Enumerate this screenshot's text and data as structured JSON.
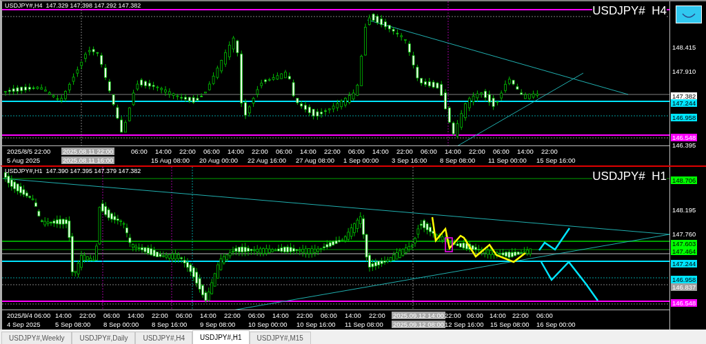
{
  "panels": [
    {
      "header": "USDJPY#,H4  147.329 147.398 147.292 147.382",
      "symbol_label": "USDJPY#  H4",
      "active": false,
      "price_axis": [
        {
          "text": "148.415",
          "kind": "tick"
        },
        {
          "text": "147.910",
          "kind": "tick"
        },
        {
          "text": "147.382",
          "kind": "marker",
          "color": "#ffffff"
        },
        {
          "text": "147.244",
          "kind": "marker",
          "color": "#00e5ff"
        },
        {
          "text": "146.958",
          "kind": "marker",
          "color": "#00e5ff"
        },
        {
          "text": "146.548",
          "kind": "marker",
          "color": "#ff00ff"
        },
        {
          "text": "146.395",
          "kind": "tick"
        }
      ],
      "time_axis_top": [
        {
          "text": "2025/8/5 22:00",
          "kind": "tick"
        },
        {
          "text": "2025.08.11 22:00",
          "kind": "cursor"
        },
        {
          "text": "06:00",
          "kind": "tick"
        },
        {
          "text": "14:00",
          "kind": "tick"
        },
        {
          "text": "22:00",
          "kind": "tick"
        },
        {
          "text": "06:00",
          "kind": "tick"
        },
        {
          "text": "14:00",
          "kind": "tick"
        },
        {
          "text": "22:00",
          "kind": "tick"
        },
        {
          "text": "06:00",
          "kind": "tick"
        },
        {
          "text": "14:00",
          "kind": "tick"
        },
        {
          "text": "22:00",
          "kind": "tick"
        },
        {
          "text": "06:00",
          "kind": "tick"
        },
        {
          "text": "14:00",
          "kind": "tick"
        },
        {
          "text": "22:00",
          "kind": "tick"
        },
        {
          "text": "06:00",
          "kind": "tick"
        },
        {
          "text": "14:00",
          "kind": "tick"
        },
        {
          "text": "22:00",
          "kind": "tick"
        },
        {
          "text": "06:00",
          "kind": "tick"
        },
        {
          "text": "14:00",
          "kind": "tick"
        },
        {
          "text": "22:00",
          "kind": "tick"
        }
      ],
      "time_axis_bottom": [
        {
          "text": "5 Aug 2025",
          "kind": "tick"
        },
        {
          "text": "2025.08.11 16:00",
          "kind": "cursor"
        },
        {
          "text": "15 Aug 08:00",
          "kind": "tick"
        },
        {
          "text": "20 Aug 00:00",
          "kind": "tick"
        },
        {
          "text": "22 Aug 16:00",
          "kind": "tick"
        },
        {
          "text": "27 Aug 08:00",
          "kind": "tick"
        },
        {
          "text": "1 Sep 00:00",
          "kind": "tick"
        },
        {
          "text": "3 Sep 16:00",
          "kind": "tick"
        },
        {
          "text": "8 Sep 08:00",
          "kind": "tick"
        },
        {
          "text": "11 Sep 00:00",
          "kind": "tick"
        },
        {
          "text": "15 Sep 16:00",
          "kind": "tick"
        }
      ]
    },
    {
      "header": "USDJPY#,H1  147.390 147.395 147.379 147.382",
      "symbol_label": "USDJPY#  H1",
      "active": true,
      "price_axis": [
        {
          "text": "148.706",
          "kind": "marker",
          "color": "#00ff00"
        },
        {
          "text": "148.195",
          "kind": "tick"
        },
        {
          "text": "147.760",
          "kind": "tick"
        },
        {
          "text": "147.603",
          "kind": "marker",
          "color": "#00ff00"
        },
        {
          "text": "147.464",
          "kind": "marker",
          "color": "#00ff00"
        },
        {
          "text": "147.244",
          "kind": "marker",
          "color": "#00e5ff"
        },
        {
          "text": "146.958",
          "kind": "marker",
          "color": "#00e5ff"
        },
        {
          "text": "146.837",
          "kind": "marker",
          "color": "#a0a0a0"
        },
        {
          "text": "146.548",
          "kind": "marker",
          "color": "#ff00ff"
        }
      ],
      "time_axis_top": [
        {
          "text": "2025/9/4 06:00",
          "kind": "tick"
        },
        {
          "text": "14:00",
          "kind": "tick"
        },
        {
          "text": "22:00",
          "kind": "tick"
        },
        {
          "text": "06:00",
          "kind": "tick"
        },
        {
          "text": "14:00",
          "kind": "tick"
        },
        {
          "text": "22:00",
          "kind": "tick"
        },
        {
          "text": "06:00",
          "kind": "tick"
        },
        {
          "text": "14:00",
          "kind": "tick"
        },
        {
          "text": "22:00",
          "kind": "tick"
        },
        {
          "text": "06:00",
          "kind": "tick"
        },
        {
          "text": "14:00",
          "kind": "tick"
        },
        {
          "text": "22:00",
          "kind": "tick"
        },
        {
          "text": "06:00",
          "kind": "tick"
        },
        {
          "text": "14:00",
          "kind": "tick"
        },
        {
          "text": "22:00",
          "kind": "tick"
        },
        {
          "text": "2025.09.12 14:00",
          "kind": "cursor"
        },
        {
          "text": "22:00",
          "kind": "tick"
        },
        {
          "text": "06:00",
          "kind": "tick"
        },
        {
          "text": "14:00",
          "kind": "tick"
        },
        {
          "text": "22:00",
          "kind": "tick"
        },
        {
          "text": "06:00",
          "kind": "tick"
        }
      ],
      "time_axis_bottom": [
        {
          "text": "4 Sep 2025",
          "kind": "tick"
        },
        {
          "text": "5 Sep 08:00",
          "kind": "tick"
        },
        {
          "text": "8 Sep 00:00",
          "kind": "tick"
        },
        {
          "text": "8 Sep 16:00",
          "kind": "tick"
        },
        {
          "text": "9 Sep 08:00",
          "kind": "tick"
        },
        {
          "text": "10 Sep 00:00",
          "kind": "tick"
        },
        {
          "text": "10 Sep 16:00",
          "kind": "tick"
        },
        {
          "text": "11 Sep 08:00",
          "kind": "tick"
        },
        {
          "text": "2025.09.12 08:00",
          "kind": "cursor"
        },
        {
          "text": "12 Sep 16:00",
          "kind": "tick"
        },
        {
          "text": "15 Sep 08:00",
          "kind": "tick"
        },
        {
          "text": "16 Sep 00:00",
          "kind": "tick"
        }
      ]
    }
  ],
  "tabs": [
    {
      "label": "USDJPY#,Weekly",
      "selected": false
    },
    {
      "label": "USDJPY#,Daily",
      "selected": false
    },
    {
      "label": "USDJPY#,H4",
      "selected": false
    },
    {
      "label": "USDJPY#,H1",
      "selected": true
    },
    {
      "label": "USDJPY#,M15",
      "selected": false
    }
  ]
}
